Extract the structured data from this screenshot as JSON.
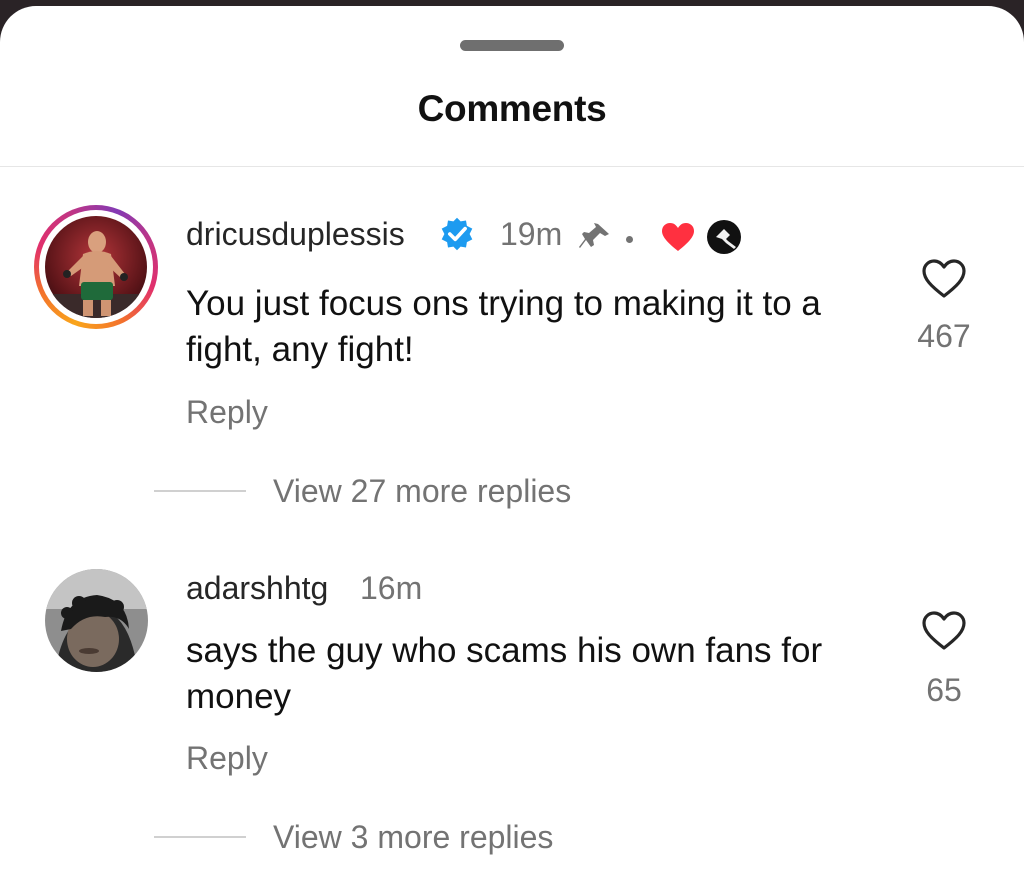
{
  "sheet": {
    "title": "Comments"
  },
  "comments": [
    {
      "username": "dricusduplessis",
      "verified": true,
      "time": "19m",
      "pinned": true,
      "creator_liked": true,
      "text": "You just focus ons trying to making it to a fight, any fight!",
      "reply_label": "Reply",
      "like_count": "467",
      "view_replies": "View 27 more replies",
      "has_story_ring": true
    },
    {
      "username": "adarshhtg",
      "verified": false,
      "time": "16m",
      "text": "says the guy who scams his own fans for money",
      "reply_label": "Reply",
      "like_count": "65",
      "view_replies": "View 3 more replies",
      "has_story_ring": false
    }
  ],
  "colors": {
    "verified_badge": "#1d9bf0",
    "heart_red": "#ff3040",
    "muted_text": "#737373"
  }
}
